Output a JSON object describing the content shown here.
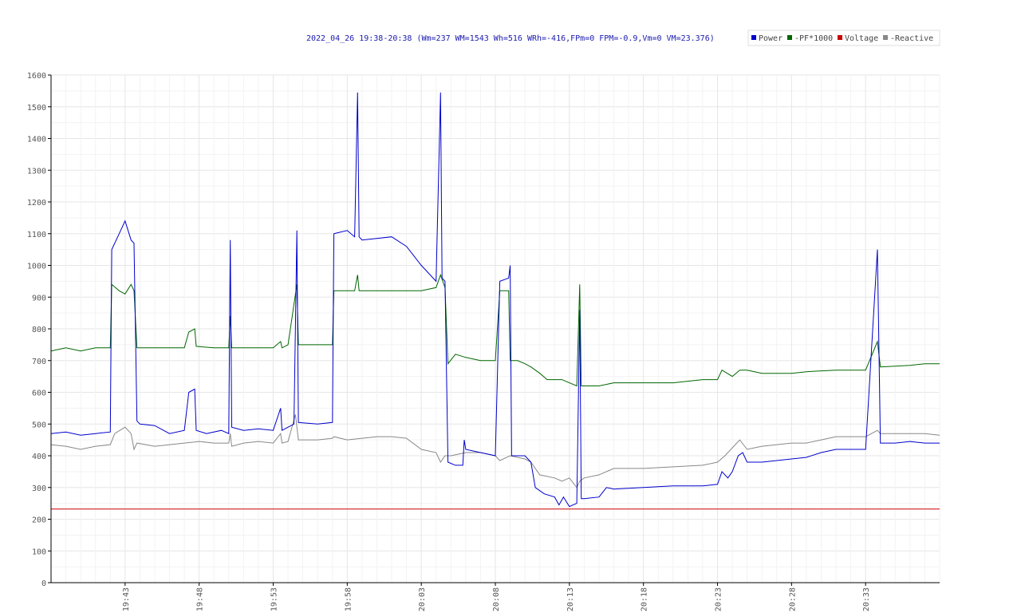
{
  "chart_data": {
    "type": "line",
    "title": "2022_04_26 19:38-20:38 (Wm=237 WM=1543 Wh=516 WRh=-416,FPm=0 FPM=-0.9,Vm=0 VM=23.376)",
    "xlabel": "",
    "ylabel": "",
    "ylim": [
      0,
      1600
    ],
    "yticks": [
      0,
      100,
      200,
      300,
      400,
      500,
      600,
      700,
      800,
      900,
      1000,
      1100,
      1200,
      1300,
      1400,
      1500,
      1600
    ],
    "x_unit": "minutes after 19:38",
    "xlim": [
      0,
      60
    ],
    "xticks": [
      {
        "x": 5,
        "label": "19:43"
      },
      {
        "x": 10,
        "label": "19:48"
      },
      {
        "x": 15,
        "label": "19:53"
      },
      {
        "x": 20,
        "label": "19:58"
      },
      {
        "x": 25,
        "label": "20:03"
      },
      {
        "x": 30,
        "label": "20:08"
      },
      {
        "x": 35,
        "label": "20:13"
      },
      {
        "x": 40,
        "label": "20:18"
      },
      {
        "x": 45,
        "label": "20:23"
      },
      {
        "x": 50,
        "label": "20:28"
      },
      {
        "x": 55,
        "label": "20:33"
      }
    ],
    "grid": true,
    "legend_position": "top-right",
    "series": [
      {
        "name": "Power",
        "color": "#0000cc",
        "points": [
          [
            0,
            470
          ],
          [
            1,
            475
          ],
          [
            2,
            465
          ],
          [
            3,
            470
          ],
          [
            4,
            475
          ],
          [
            4.1,
            1050
          ],
          [
            4.6,
            1100
          ],
          [
            5,
            1140
          ],
          [
            5.4,
            1080
          ],
          [
            5.6,
            1070
          ],
          [
            5.8,
            510
          ],
          [
            6,
            500
          ],
          [
            7,
            495
          ],
          [
            8,
            470
          ],
          [
            9,
            480
          ],
          [
            9.3,
            600
          ],
          [
            9.7,
            610
          ],
          [
            9.8,
            480
          ],
          [
            10.5,
            470
          ],
          [
            11.5,
            480
          ],
          [
            12,
            470
          ],
          [
            12.1,
            1080
          ],
          [
            12.2,
            490
          ],
          [
            13,
            480
          ],
          [
            14,
            485
          ],
          [
            15,
            480
          ],
          [
            15.5,
            550
          ],
          [
            15.6,
            480
          ],
          [
            16,
            490
          ],
          [
            16.4,
            500
          ],
          [
            16.6,
            1110
          ],
          [
            16.7,
            505
          ],
          [
            18,
            500
          ],
          [
            19,
            505
          ],
          [
            19.1,
            1100
          ],
          [
            20,
            1110
          ],
          [
            20.5,
            1090
          ],
          [
            20.7,
            1545
          ],
          [
            20.8,
            1090
          ],
          [
            21,
            1080
          ],
          [
            23,
            1090
          ],
          [
            24,
            1060
          ],
          [
            25,
            1000
          ],
          [
            26,
            950
          ],
          [
            26.3,
            1545
          ],
          [
            26.4,
            960
          ],
          [
            26.6,
            950
          ],
          [
            26.8,
            380
          ],
          [
            27.3,
            370
          ],
          [
            27.8,
            370
          ],
          [
            27.9,
            450
          ],
          [
            28,
            420
          ],
          [
            29,
            410
          ],
          [
            30,
            400
          ],
          [
            30.3,
            950
          ],
          [
            30.9,
            960
          ],
          [
            31,
            1000
          ],
          [
            31.1,
            400
          ],
          [
            32,
            400
          ],
          [
            32.4,
            380
          ],
          [
            32.7,
            300
          ],
          [
            33.3,
            280
          ],
          [
            34,
            270
          ],
          [
            34.3,
            245
          ],
          [
            34.6,
            270
          ],
          [
            35,
            240
          ],
          [
            35.5,
            250
          ],
          [
            35.7,
            860
          ],
          [
            35.8,
            265
          ],
          [
            36,
            265
          ],
          [
            37,
            270
          ],
          [
            37.5,
            300
          ],
          [
            38,
            295
          ],
          [
            40,
            300
          ],
          [
            42,
            305
          ],
          [
            44,
            305
          ],
          [
            45,
            310
          ],
          [
            45.3,
            350
          ],
          [
            45.7,
            330
          ],
          [
            46,
            350
          ],
          [
            46.4,
            400
          ],
          [
            46.7,
            410
          ],
          [
            47,
            380
          ],
          [
            48,
            380
          ],
          [
            50,
            390
          ],
          [
            51,
            395
          ],
          [
            52,
            410
          ],
          [
            53,
            420
          ],
          [
            55,
            420
          ],
          [
            55.8,
            1050
          ],
          [
            56,
            440
          ],
          [
            57,
            440
          ],
          [
            58,
            445
          ],
          [
            59,
            440
          ],
          [
            60,
            440
          ]
        ]
      },
      {
        "name": "-PF*1000",
        "color": "#006600",
        "points": [
          [
            0,
            730
          ],
          [
            1,
            740
          ],
          [
            2,
            730
          ],
          [
            3,
            740
          ],
          [
            4,
            740
          ],
          [
            4.1,
            940
          ],
          [
            4.6,
            920
          ],
          [
            5,
            910
          ],
          [
            5.4,
            940
          ],
          [
            5.6,
            920
          ],
          [
            5.8,
            740
          ],
          [
            7,
            740
          ],
          [
            9,
            740
          ],
          [
            9.3,
            790
          ],
          [
            9.7,
            800
          ],
          [
            9.8,
            745
          ],
          [
            11,
            740
          ],
          [
            12,
            740
          ],
          [
            12.1,
            840
          ],
          [
            12.2,
            740
          ],
          [
            13,
            740
          ],
          [
            15,
            740
          ],
          [
            15.5,
            760
          ],
          [
            15.6,
            740
          ],
          [
            16,
            750
          ],
          [
            16.6,
            940
          ],
          [
            16.7,
            750
          ],
          [
            18,
            750
          ],
          [
            19,
            750
          ],
          [
            19.1,
            920
          ],
          [
            20,
            920
          ],
          [
            20.5,
            920
          ],
          [
            20.7,
            970
          ],
          [
            20.8,
            920
          ],
          [
            22,
            920
          ],
          [
            24,
            920
          ],
          [
            25,
            920
          ],
          [
            26,
            930
          ],
          [
            26.3,
            970
          ],
          [
            26.6,
            930
          ],
          [
            26.8,
            690
          ],
          [
            27.3,
            720
          ],
          [
            28,
            710
          ],
          [
            29,
            700
          ],
          [
            30,
            700
          ],
          [
            30.3,
            920
          ],
          [
            30.9,
            920
          ],
          [
            31,
            700
          ],
          [
            31.5,
            700
          ],
          [
            32,
            690
          ],
          [
            32.4,
            680
          ],
          [
            33,
            660
          ],
          [
            33.5,
            640
          ],
          [
            34,
            640
          ],
          [
            34.5,
            640
          ],
          [
            35,
            630
          ],
          [
            35.5,
            620
          ],
          [
            35.7,
            940
          ],
          [
            35.8,
            620
          ],
          [
            36,
            620
          ],
          [
            37,
            620
          ],
          [
            38,
            630
          ],
          [
            40,
            630
          ],
          [
            42,
            630
          ],
          [
            44,
            640
          ],
          [
            45,
            640
          ],
          [
            45.3,
            670
          ],
          [
            46,
            650
          ],
          [
            46.5,
            670
          ],
          [
            47,
            670
          ],
          [
            48,
            660
          ],
          [
            50,
            660
          ],
          [
            51,
            665
          ],
          [
            53,
            670
          ],
          [
            55,
            670
          ],
          [
            55.8,
            760
          ],
          [
            56,
            680
          ],
          [
            58,
            685
          ],
          [
            59,
            690
          ],
          [
            60,
            690
          ]
        ]
      },
      {
        "name": "Voltage",
        "color": "#cc0000",
        "points": [
          [
            0,
            232
          ],
          [
            60,
            232
          ]
        ]
      },
      {
        "name": "-Reactive",
        "color": "#888888",
        "points": [
          [
            0,
            435
          ],
          [
            1,
            430
          ],
          [
            2,
            420
          ],
          [
            3,
            430
          ],
          [
            4,
            435
          ],
          [
            4.3,
            470
          ],
          [
            5,
            490
          ],
          [
            5.4,
            470
          ],
          [
            5.6,
            420
          ],
          [
            5.8,
            440
          ],
          [
            7,
            430
          ],
          [
            8,
            435
          ],
          [
            9,
            440
          ],
          [
            10,
            445
          ],
          [
            11,
            440
          ],
          [
            12,
            440
          ],
          [
            12.1,
            470
          ],
          [
            12.2,
            430
          ],
          [
            13,
            440
          ],
          [
            14,
            445
          ],
          [
            15,
            440
          ],
          [
            15.5,
            470
          ],
          [
            15.6,
            440
          ],
          [
            16,
            445
          ],
          [
            16.5,
            530
          ],
          [
            16.7,
            450
          ],
          [
            18,
            450
          ],
          [
            19,
            455
          ],
          [
            19.1,
            460
          ],
          [
            20,
            450
          ],
          [
            21,
            455
          ],
          [
            22,
            460
          ],
          [
            23,
            460
          ],
          [
            24,
            455
          ],
          [
            25,
            420
          ],
          [
            26,
            410
          ],
          [
            26.3,
            380
          ],
          [
            26.6,
            400
          ],
          [
            27,
            400
          ],
          [
            28,
            410
          ],
          [
            29,
            410
          ],
          [
            30,
            400
          ],
          [
            30.3,
            385
          ],
          [
            31,
            400
          ],
          [
            32,
            390
          ],
          [
            32.4,
            380
          ],
          [
            33,
            340
          ],
          [
            34,
            330
          ],
          [
            34.5,
            320
          ],
          [
            35,
            330
          ],
          [
            35.5,
            300
          ],
          [
            35.7,
            320
          ],
          [
            36,
            330
          ],
          [
            37,
            340
          ],
          [
            38,
            360
          ],
          [
            40,
            360
          ],
          [
            42,
            365
          ],
          [
            44,
            370
          ],
          [
            45,
            380
          ],
          [
            45.5,
            400
          ],
          [
            46.5,
            450
          ],
          [
            47,
            420
          ],
          [
            48,
            430
          ],
          [
            50,
            440
          ],
          [
            51,
            440
          ],
          [
            52,
            450
          ],
          [
            53,
            460
          ],
          [
            54,
            460
          ],
          [
            55,
            460
          ],
          [
            55.8,
            480
          ],
          [
            56,
            470
          ],
          [
            58,
            470
          ],
          [
            59,
            470
          ],
          [
            60,
            465
          ]
        ]
      }
    ]
  }
}
